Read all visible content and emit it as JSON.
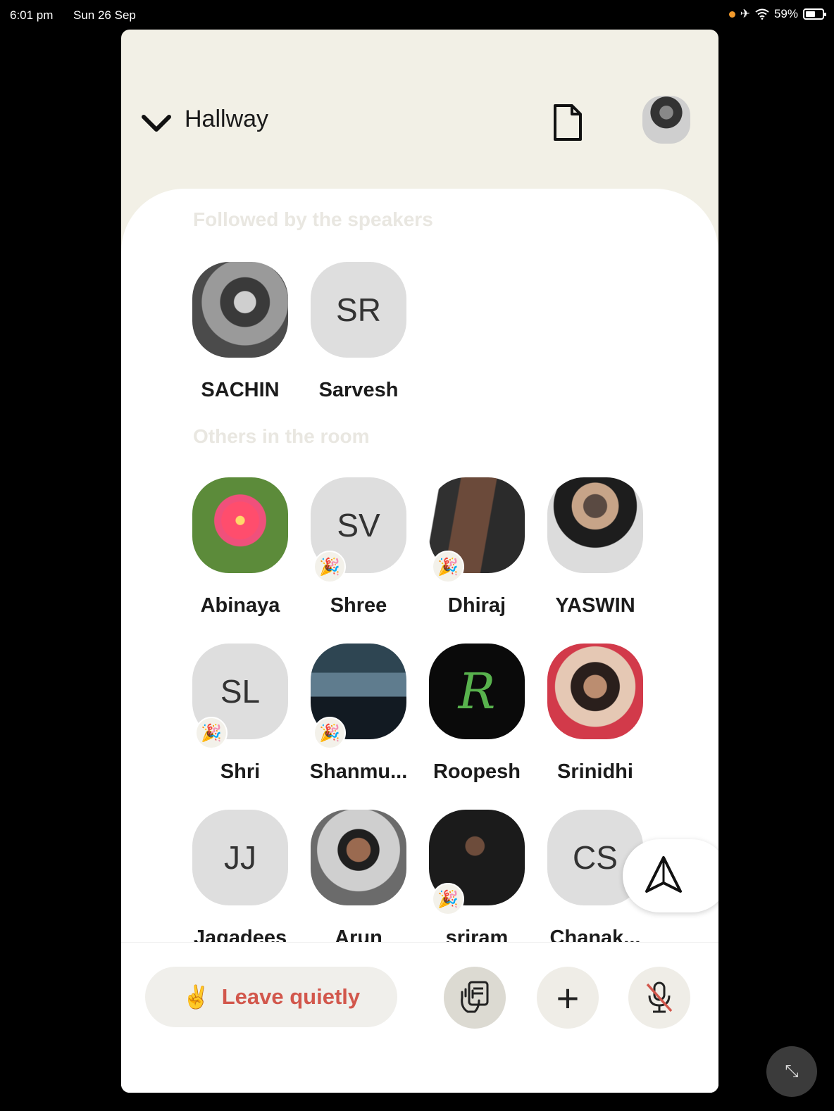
{
  "status_bar": {
    "time": "6:01 pm",
    "date": "Sun 26 Sep",
    "battery": "59%",
    "battery_level": 0.59,
    "icons": [
      "recording-dot-icon",
      "airplane-icon",
      "wifi-icon",
      "battery-icon"
    ]
  },
  "header": {
    "room_title": "Hallway",
    "icons": [
      "chevron-down-icon",
      "document-icon",
      "profile-avatar"
    ]
  },
  "sections": {
    "followed": "Followed by the speakers",
    "others": "Others in the room"
  },
  "followed_people": [
    {
      "name": "SACHIN",
      "initials": ""
    },
    {
      "name": "Sarvesh",
      "initials": "SR"
    }
  ],
  "others_people": [
    {
      "name": "Abinaya",
      "initials": ""
    },
    {
      "name": "Shree",
      "initials": "SV"
    },
    {
      "name": "Dhiraj",
      "initials": ""
    },
    {
      "name": "YASWIN",
      "initials": ""
    },
    {
      "name": "Shri",
      "initials": "SL"
    },
    {
      "name": "Shanmu...",
      "initials": ""
    },
    {
      "name": "Roopesh",
      "initials": "R"
    },
    {
      "name": "Srinidhi",
      "initials": ""
    },
    {
      "name": "Jagadees",
      "initials": "JJ"
    },
    {
      "name": "Arun",
      "initials": ""
    },
    {
      "name": "sriram",
      "initials": ""
    },
    {
      "name": "Chanak...",
      "initials": "CS"
    }
  ],
  "badges": {
    "new_user": "🎉"
  },
  "actions": {
    "leave_emoji": "✌️",
    "leave_label": "Leave quietly",
    "raise_hand_icon": "raise-hand-icon",
    "add_icon": "plus-icon",
    "add_label": "+",
    "mic_icon": "mic-muted-icon"
  },
  "colors": {
    "header_bg": "#f2f0e6",
    "leave_text": "#d2574c",
    "sheet_bg": "#ffffff"
  }
}
